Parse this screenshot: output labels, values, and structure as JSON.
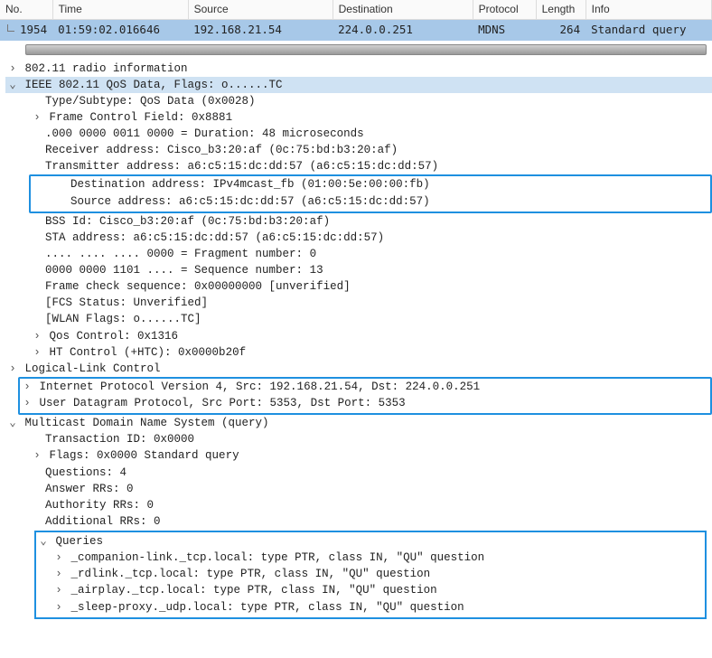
{
  "columns": {
    "no": "No.",
    "time": "Time",
    "source": "Source",
    "destination": "Destination",
    "protocol": "Protocol",
    "length": "Length",
    "info": "Info"
  },
  "packet": {
    "no": "1954",
    "time": "01:59:02.016646",
    "source": "192.168.21.54",
    "destination": "224.0.0.251",
    "protocol": "MDNS",
    "length": "264",
    "info": "Standard query"
  },
  "tree": {
    "radio": "802.11 radio information",
    "ieee_hdr": "IEEE 802.11 QoS Data, Flags: o......TC",
    "ieee": {
      "type_subtype": "Type/Subtype: QoS Data (0x0028)",
      "fcf": "Frame Control Field: 0x8881",
      "duration": ".000 0000 0011 0000 = Duration: 48 microseconds",
      "receiver": "Receiver address: Cisco_b3:20:af (0c:75:bd:b3:20:af)",
      "transmitter": "Transmitter address: a6:c5:15:dc:dd:57 (a6:c5:15:dc:dd:57)",
      "dest": "Destination address: IPv4mcast_fb (01:00:5e:00:00:fb)",
      "src": "Source address: a6:c5:15:dc:dd:57 (a6:c5:15:dc:dd:57)",
      "bssid": "BSS Id: Cisco_b3:20:af (0c:75:bd:b3:20:af)",
      "sta": "STA address: a6:c5:15:dc:dd:57 (a6:c5:15:dc:dd:57)",
      "frag": ".... .... .... 0000 = Fragment number: 0",
      "seq": "0000 0000 1101 .... = Sequence number: 13",
      "fcs": "Frame check sequence: 0x00000000 [unverified]",
      "fcs_status": "[FCS Status: Unverified]",
      "wlan_flags": "[WLAN Flags: o......TC]",
      "qos": "Qos Control: 0x1316",
      "ht": "HT Control (+HTC): 0x0000b20f"
    },
    "llc": "Logical-Link Control",
    "ipv4": "Internet Protocol Version 4, Src: 192.168.21.54, Dst: 224.0.0.251",
    "udp": "User Datagram Protocol, Src Port: 5353, Dst Port: 5353",
    "mdns_hdr": "Multicast Domain Name System (query)",
    "mdns": {
      "txid": "Transaction ID: 0x0000",
      "flags": "Flags: 0x0000 Standard query",
      "questions": "Questions: 4",
      "answers": "Answer RRs: 0",
      "authority": "Authority RRs: 0",
      "additional": "Additional RRs: 0",
      "queries_label": "Queries",
      "queries": [
        "_companion-link._tcp.local: type PTR, class IN, \"QU\" question",
        "_rdlink._tcp.local: type PTR, class IN, \"QU\" question",
        "_airplay._tcp.local: type PTR, class IN, \"QU\" question",
        "_sleep-proxy._udp.local: type PTR, class IN, \"QU\" question"
      ]
    }
  }
}
